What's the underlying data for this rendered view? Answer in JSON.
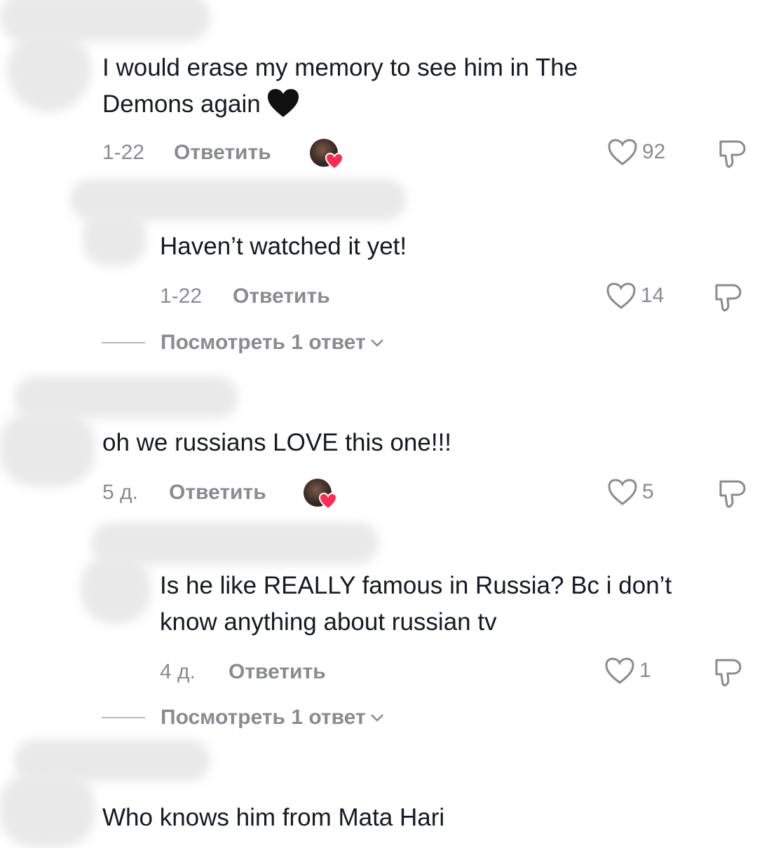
{
  "comments": [
    {
      "text_line1": "I would erase my memory to see him in The",
      "text_line2": "Demons again",
      "emoji": "black-heart",
      "date": "1-22",
      "reply_label": "Ответить",
      "likes": "92",
      "creator_liked": true
    },
    {
      "text": "Haven’t watched it yet!",
      "date": "1-22",
      "reply_label": "Ответить",
      "likes": "14",
      "creator_liked": false
    },
    {
      "text": "oh we russians LOVE this one!!!",
      "date": "5 д.",
      "reply_label": "Ответить",
      "likes": "5",
      "creator_liked": true
    },
    {
      "text_line1": "Is he like REALLY famous in Russia? Bc i don’t",
      "text_line2": "know anything about russian tv",
      "date": "4 д.",
      "reply_label": "Ответить",
      "likes": "1",
      "creator_liked": false
    },
    {
      "text": "Who knows him from Mata Hari"
    }
  ],
  "view_replies": [
    {
      "label": "Посмотреть 1 ответ"
    },
    {
      "label": "Посмотреть 1 ответ"
    }
  ],
  "colors": {
    "text": "#161823",
    "secondary": "#8a8b91",
    "heart_badge": "#fe2c55"
  }
}
